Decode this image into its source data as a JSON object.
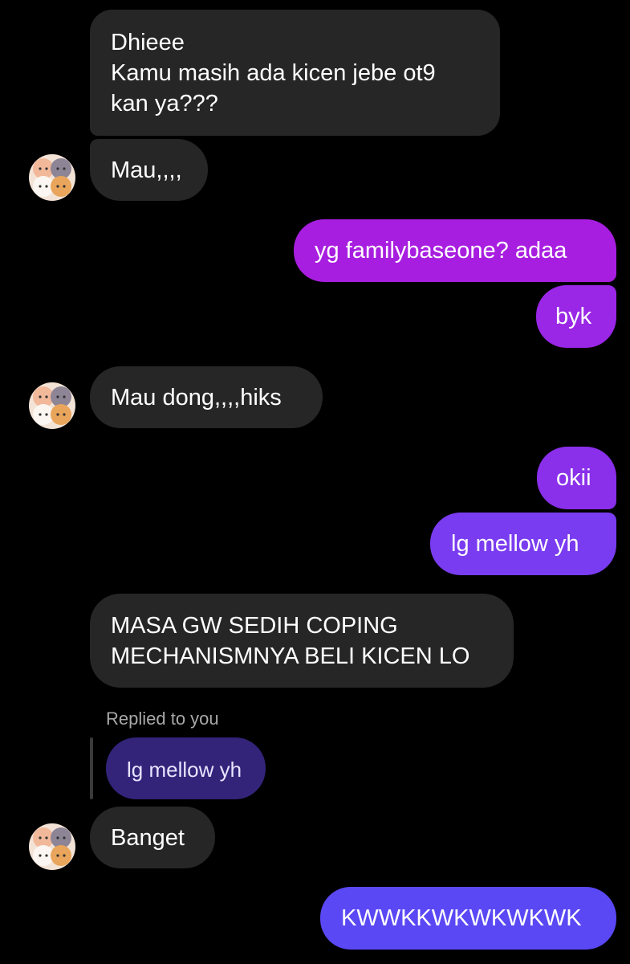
{
  "messages": [
    {
      "id": "m1",
      "from": "them",
      "text": "Dhieee\nKamu masih ada kicen jebe ot9\nkan ya???"
    },
    {
      "id": "m2",
      "from": "them",
      "text": "Mau,,,,"
    },
    {
      "id": "m3",
      "from": "me",
      "text": "yg familybaseone? adaa"
    },
    {
      "id": "m4",
      "from": "me",
      "text": "byk"
    },
    {
      "id": "m5",
      "from": "them",
      "text": "Mau dong,,,,hiks"
    },
    {
      "id": "m6",
      "from": "me",
      "text": "okii"
    },
    {
      "id": "m7",
      "from": "me",
      "text": "lg mellow yh"
    },
    {
      "id": "m8",
      "from": "them",
      "text": "MASA GW SEDIH COPING\nMECHANISMNYA BELI KICEN LO"
    },
    {
      "id": "m9",
      "from": "them",
      "text": "Banget"
    },
    {
      "id": "m10",
      "from": "me",
      "text": "KWWKKWKWKWKWK"
    }
  ],
  "reply": {
    "label": "Replied to you",
    "quoted_text": "lg mellow yh"
  },
  "colors": {
    "incoming": "#262626",
    "outgoing_top": "#a81ee0",
    "outgoing_mid": "#7a3cf0",
    "outgoing_bottom": "#5a48f5",
    "quoted": "#33247a"
  },
  "avatar": {
    "icon": "cats-avatar-icon"
  }
}
